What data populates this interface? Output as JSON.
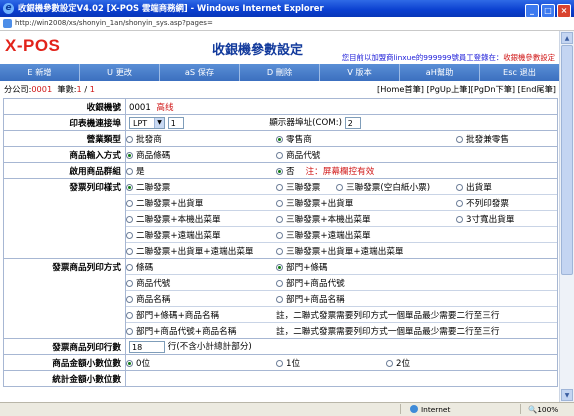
{
  "window": {
    "title": "收銀機參數設定V4.02 [X-POS 雲端商務網] - Windows Internet Explorer",
    "address": "http://win2008/xs/shonyin_1an/shonyin_sys.asp?pages="
  },
  "header": {
    "logo": "X-POS",
    "title": "收銀機參數設定",
    "notice_prefix": "您目前以加盟商linxue的999999號員工登錄在：",
    "notice_suffix": "收銀機參數設定"
  },
  "toolbar": [
    {
      "label": "E 新增"
    },
    {
      "label": "U 更改"
    },
    {
      "label": "aS 保存"
    },
    {
      "label": "D 刪除"
    },
    {
      "label": "V 版本"
    },
    {
      "label": "aH幫助"
    },
    {
      "label": "Esc 退出"
    }
  ],
  "info": {
    "company_label": "分公司:",
    "company_value": "0001",
    "count_label": "筆數:",
    "count_value": "1",
    "count_total": "1",
    "nav": "[Home首筆] [PgUp上筆][PgDn下筆] [End尾筆]"
  },
  "form": {
    "register": {
      "label": "收銀機號",
      "number": "0001",
      "name": "高线"
    },
    "printer_port": {
      "label": "印表機連接埠",
      "port": "LPT",
      "port_num": "1",
      "display_label": "顯示器埠址(COM:)",
      "display_value": "2"
    },
    "business_type": {
      "label": "營業類型",
      "options": [
        "批發商",
        "零售商",
        "批發兼零售"
      ]
    },
    "product_input": {
      "label": "商品輸入方式",
      "options": [
        "商品條碼",
        "商品代號"
      ]
    },
    "product_group": {
      "label": "啟用商品群組",
      "options": [
        "是",
        "否"
      ],
      "note": "注：屏幕欄控有效"
    },
    "invoice_print": {
      "label": "發票列印樣式",
      "rows": [
        [
          "二聯發票",
          "三聯發票",
          "三聯發票(空白紙小票)",
          "出貨單"
        ],
        [
          "二聯發票+出貨單",
          "三聯發票+出貨單",
          "",
          "不列印發票"
        ],
        [
          "二聯發票+本機出菜單",
          "三聯發票+本機出菜單",
          "",
          "3寸寬出貨單"
        ],
        [
          "二聯發票+遠端出菜單",
          "三聯發票+遠端出菜單",
          "",
          ""
        ],
        [
          "二聯發票+出貨單+遠端出菜單",
          "三聯發票+出貨單+遠端出菜單",
          "",
          ""
        ]
      ]
    },
    "invoice_product_print": {
      "label": "發票商品列印方式",
      "rows": [
        [
          "條碼",
          "部門+條碼",
          ""
        ],
        [
          "商品代號",
          "部門+商品代號",
          ""
        ],
        [
          "商品名稱",
          "部門+商品名稱",
          ""
        ],
        [
          "部門+條碼+商品名稱",
          "",
          "註，二聯式發票需要列印方式一個單品最少需要二行至三行"
        ],
        [
          "部門+商品代號+商品名稱",
          "",
          "註，二聯式發票需要列印方式一個單品最少需要二行至三行"
        ]
      ]
    },
    "invoice_lines": {
      "label": "發票商品列印行數",
      "value": "18",
      "suffix": "行(不含小計總計部分)"
    },
    "amount_decimals": {
      "label": "商品金額小數位數",
      "options": [
        "0位",
        "1位",
        "2位"
      ]
    },
    "partial_label": "統計金額小數位數"
  },
  "status": {
    "zone": "Internet",
    "zoom": "100%"
  }
}
